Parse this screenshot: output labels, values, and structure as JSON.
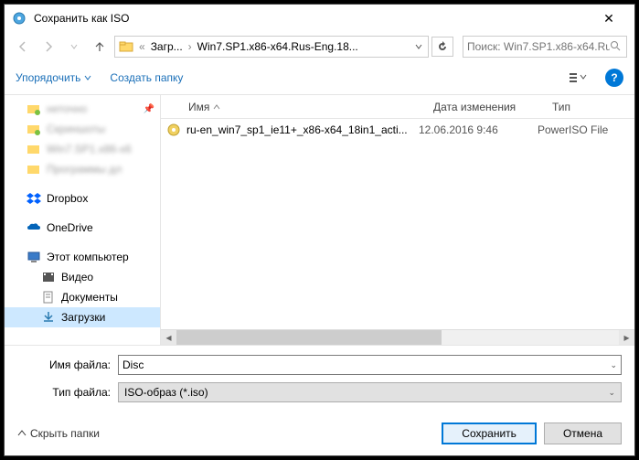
{
  "title": "Сохранить как ISO",
  "breadcrumb": {
    "part1": "Загр...",
    "part2": "Win7.SP1.x86-x64.Rus-Eng.18..."
  },
  "search_placeholder": "Поиск: Win7.SP1.x86-x64.Rus...",
  "toolbar": {
    "organize": "Упорядочить",
    "newfolder": "Создать папку"
  },
  "columns": {
    "name": "Имя",
    "date": "Дата изменения",
    "type": "Тип"
  },
  "sidebar": {
    "blur1": "неточно",
    "blur2": "Скриншоты",
    "blur3": "Win7.SP1.x86-x6",
    "blur4": "Программы дл",
    "dropbox": "Dropbox",
    "onedrive": "OneDrive",
    "thispc": "Этот компьютер",
    "video": "Видео",
    "documents": "Документы",
    "downloads": "Загрузки"
  },
  "file": {
    "name": "ru-en_win7_sp1_ie11+_x86-x64_18in1_acti...",
    "date": "12.06.2016 9:46",
    "type": "PowerISO File"
  },
  "labels": {
    "filename": "Имя файла:",
    "filetype": "Тип файла:"
  },
  "values": {
    "filename": "Disc",
    "filetype": "ISO-образ (*.iso)"
  },
  "footer": {
    "hide": "Скрыть папки",
    "save": "Сохранить",
    "cancel": "Отмена"
  }
}
